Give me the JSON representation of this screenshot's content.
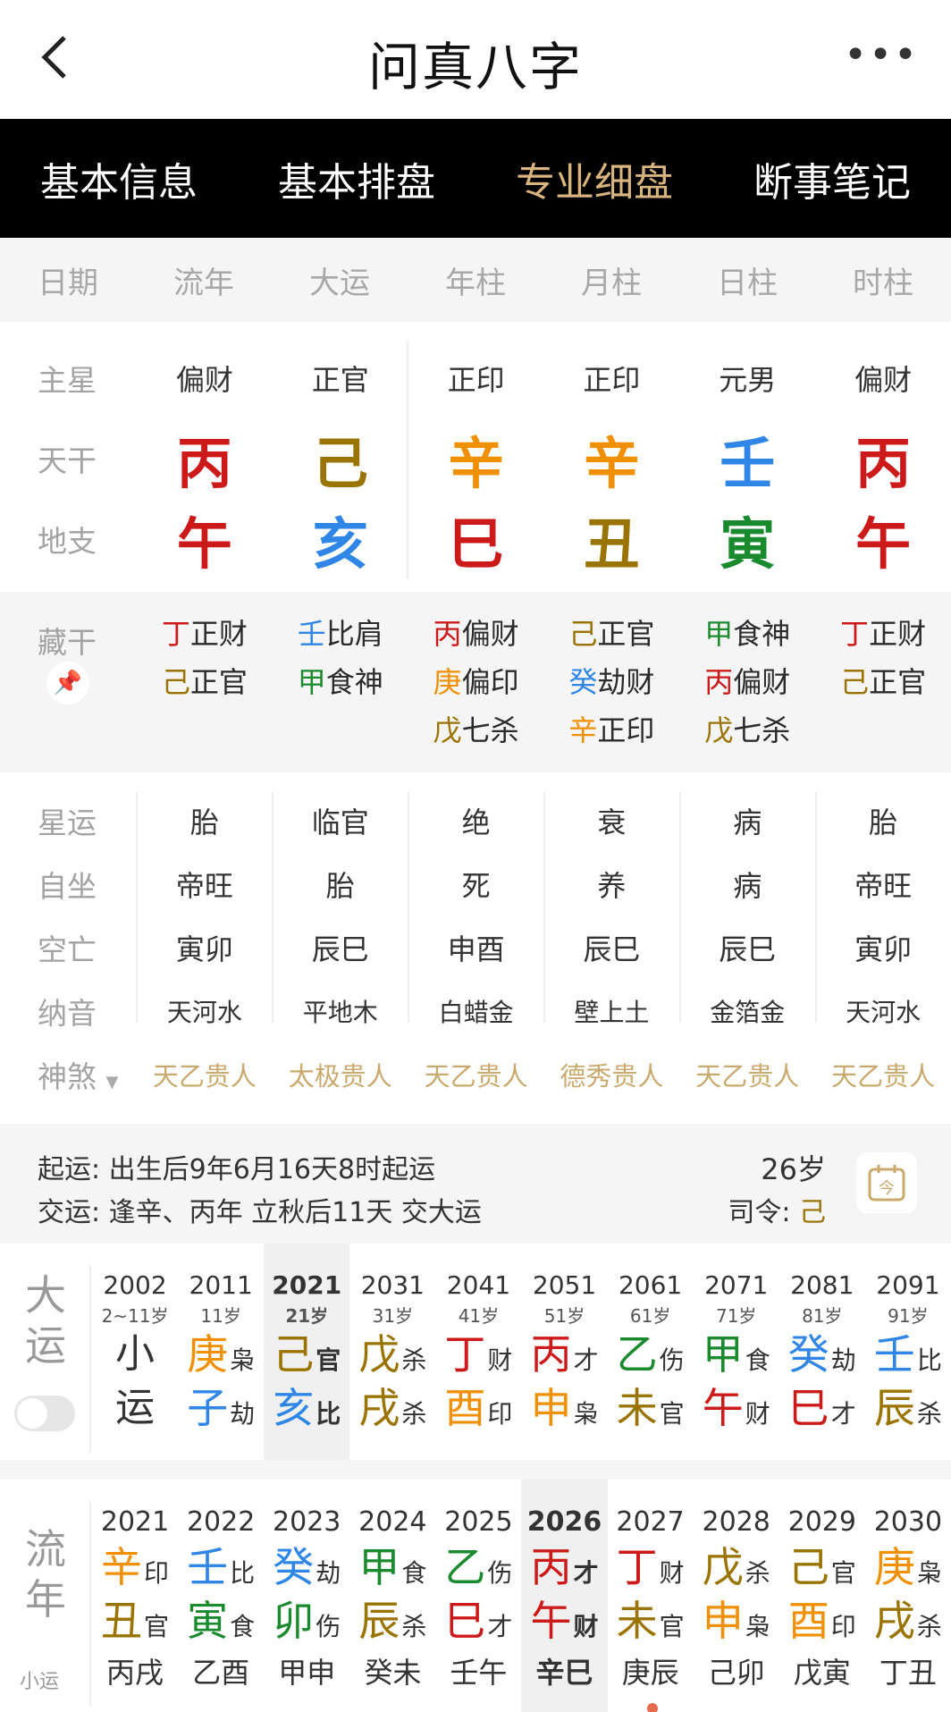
{
  "header": {
    "title": "问真八字"
  },
  "tabs": [
    "基本信息",
    "基本排盘",
    "专业细盘",
    "断事笔记"
  ],
  "columns": [
    "日期",
    "流年",
    "大运",
    "年柱",
    "月柱",
    "日柱",
    "时柱"
  ],
  "labels": {
    "main_star": "主星",
    "heaven": "天干",
    "earth": "地支",
    "hidden": "藏干",
    "xingyun": "星运",
    "zizuo": "自坐",
    "kongwang": "空亡",
    "nayin": "纳音",
    "shensha": "神煞"
  },
  "main_star": [
    "偏财",
    "正官",
    "正印",
    "正印",
    "元男",
    "偏财"
  ],
  "heaven": [
    "丙",
    "己",
    "辛",
    "辛",
    "壬",
    "丙"
  ],
  "earth": [
    "午",
    "亥",
    "巳",
    "丑",
    "寅",
    "午"
  ],
  "hidden": [
    [
      {
        "g": "丁",
        "s": "正财"
      },
      {
        "g": "己",
        "s": "正官"
      }
    ],
    [
      {
        "g": "壬",
        "s": "比肩"
      },
      {
        "g": "甲",
        "s": "食神"
      }
    ],
    [
      {
        "g": "丙",
        "s": "偏财"
      },
      {
        "g": "庚",
        "s": "偏印"
      },
      {
        "g": "戊",
        "s": "七杀"
      }
    ],
    [
      {
        "g": "己",
        "s": "正官"
      },
      {
        "g": "癸",
        "s": "劫财"
      },
      {
        "g": "辛",
        "s": "正印"
      }
    ],
    [
      {
        "g": "甲",
        "s": "食神"
      },
      {
        "g": "丙",
        "s": "偏财"
      },
      {
        "g": "戊",
        "s": "七杀"
      }
    ],
    [
      {
        "g": "丁",
        "s": "正财"
      },
      {
        "g": "己",
        "s": "正官"
      }
    ]
  ],
  "xingyun": [
    "胎",
    "临官",
    "绝",
    "衰",
    "病",
    "胎"
  ],
  "zizuo": [
    "帝旺",
    "胎",
    "死",
    "养",
    "病",
    "帝旺"
  ],
  "kongwang": [
    "寅卯",
    "辰巳",
    "申酉",
    "辰巳",
    "辰巳",
    "寅卯"
  ],
  "nayin": [
    "天河水",
    "平地木",
    "白蜡金",
    "壁上土",
    "金箔金",
    "天河水"
  ],
  "shensha": [
    "天乙贵人",
    "太极贵人",
    "天乙贵人",
    "德秀贵人",
    "天乙贵人",
    "天乙贵人"
  ],
  "qiyun": {
    "line1": "起运:  出生后9年6月16天8时起运",
    "line2": "交运:  逢辛、丙年 立秋后11天 交大运",
    "age": "26岁",
    "siling_label": "司令:",
    "siling_value": "己"
  },
  "dayun": {
    "label1": "大",
    "label2": "运",
    "small_label1": "小",
    "small_label2": "运",
    "cols": [
      {
        "yr": "2002",
        "ag": "2~11岁",
        "small": true
      },
      {
        "yr": "2011",
        "ag": "11岁",
        "g1": "庚",
        "s1": "枭",
        "g2": "子",
        "s2": "劫"
      },
      {
        "yr": "2021",
        "ag": "21岁",
        "g1": "己",
        "s1": "官",
        "g2": "亥",
        "s2": "比",
        "sel": true
      },
      {
        "yr": "2031",
        "ag": "31岁",
        "g1": "戊",
        "s1": "杀",
        "g2": "戌",
        "s2": "杀"
      },
      {
        "yr": "2041",
        "ag": "41岁",
        "g1": "丁",
        "s1": "财",
        "g2": "酉",
        "s2": "印"
      },
      {
        "yr": "2051",
        "ag": "51岁",
        "g1": "丙",
        "s1": "才",
        "g2": "申",
        "s2": "枭"
      },
      {
        "yr": "2061",
        "ag": "61岁",
        "g1": "乙",
        "s1": "伤",
        "g2": "未",
        "s2": "官"
      },
      {
        "yr": "2071",
        "ag": "71岁",
        "g1": "甲",
        "s1": "食",
        "g2": "午",
        "s2": "财"
      },
      {
        "yr": "2081",
        "ag": "81岁",
        "g1": "癸",
        "s1": "劫",
        "g2": "巳",
        "s2": "才"
      },
      {
        "yr": "2091",
        "ag": "91岁",
        "g1": "壬",
        "s1": "比",
        "g2": "辰",
        "s2": "杀"
      }
    ]
  },
  "liunian": {
    "label1": "流",
    "label2": "年",
    "xiaoyun": "小运",
    "cols": [
      {
        "yr": "2021",
        "g1": "辛",
        "s1": "印",
        "g2": "丑",
        "s2": "官",
        "xy": "丙戌"
      },
      {
        "yr": "2022",
        "g1": "壬",
        "s1": "比",
        "g2": "寅",
        "s2": "食",
        "xy": "乙酉"
      },
      {
        "yr": "2023",
        "g1": "癸",
        "s1": "劫",
        "g2": "卯",
        "s2": "伤",
        "xy": "甲申"
      },
      {
        "yr": "2024",
        "g1": "甲",
        "s1": "食",
        "g2": "辰",
        "s2": "杀",
        "xy": "癸未"
      },
      {
        "yr": "2025",
        "g1": "乙",
        "s1": "伤",
        "g2": "巳",
        "s2": "才",
        "xy": "壬午"
      },
      {
        "yr": "2026",
        "g1": "丙",
        "s1": "才",
        "g2": "午",
        "s2": "财",
        "xy": "辛巳",
        "sel": true
      },
      {
        "yr": "2027",
        "g1": "丁",
        "s1": "财",
        "g2": "未",
        "s2": "官",
        "xy": "庚辰"
      },
      {
        "yr": "2028",
        "g1": "戊",
        "s1": "杀",
        "g2": "申",
        "s2": "枭",
        "xy": "己卯"
      },
      {
        "yr": "2029",
        "g1": "己",
        "s1": "官",
        "g2": "酉",
        "s2": "印",
        "xy": "戊寅"
      },
      {
        "yr": "2030",
        "g1": "庚",
        "s1": "枭",
        "g2": "戌",
        "s2": "杀",
        "xy": "丁丑"
      }
    ]
  },
  "colors": {
    "accent": "#d8b57f",
    "fire": "#cc1a1a",
    "earth": "#9a7400",
    "metal": "#f08f00",
    "water": "#2f86e6",
    "wood": "#1a8a2e"
  }
}
